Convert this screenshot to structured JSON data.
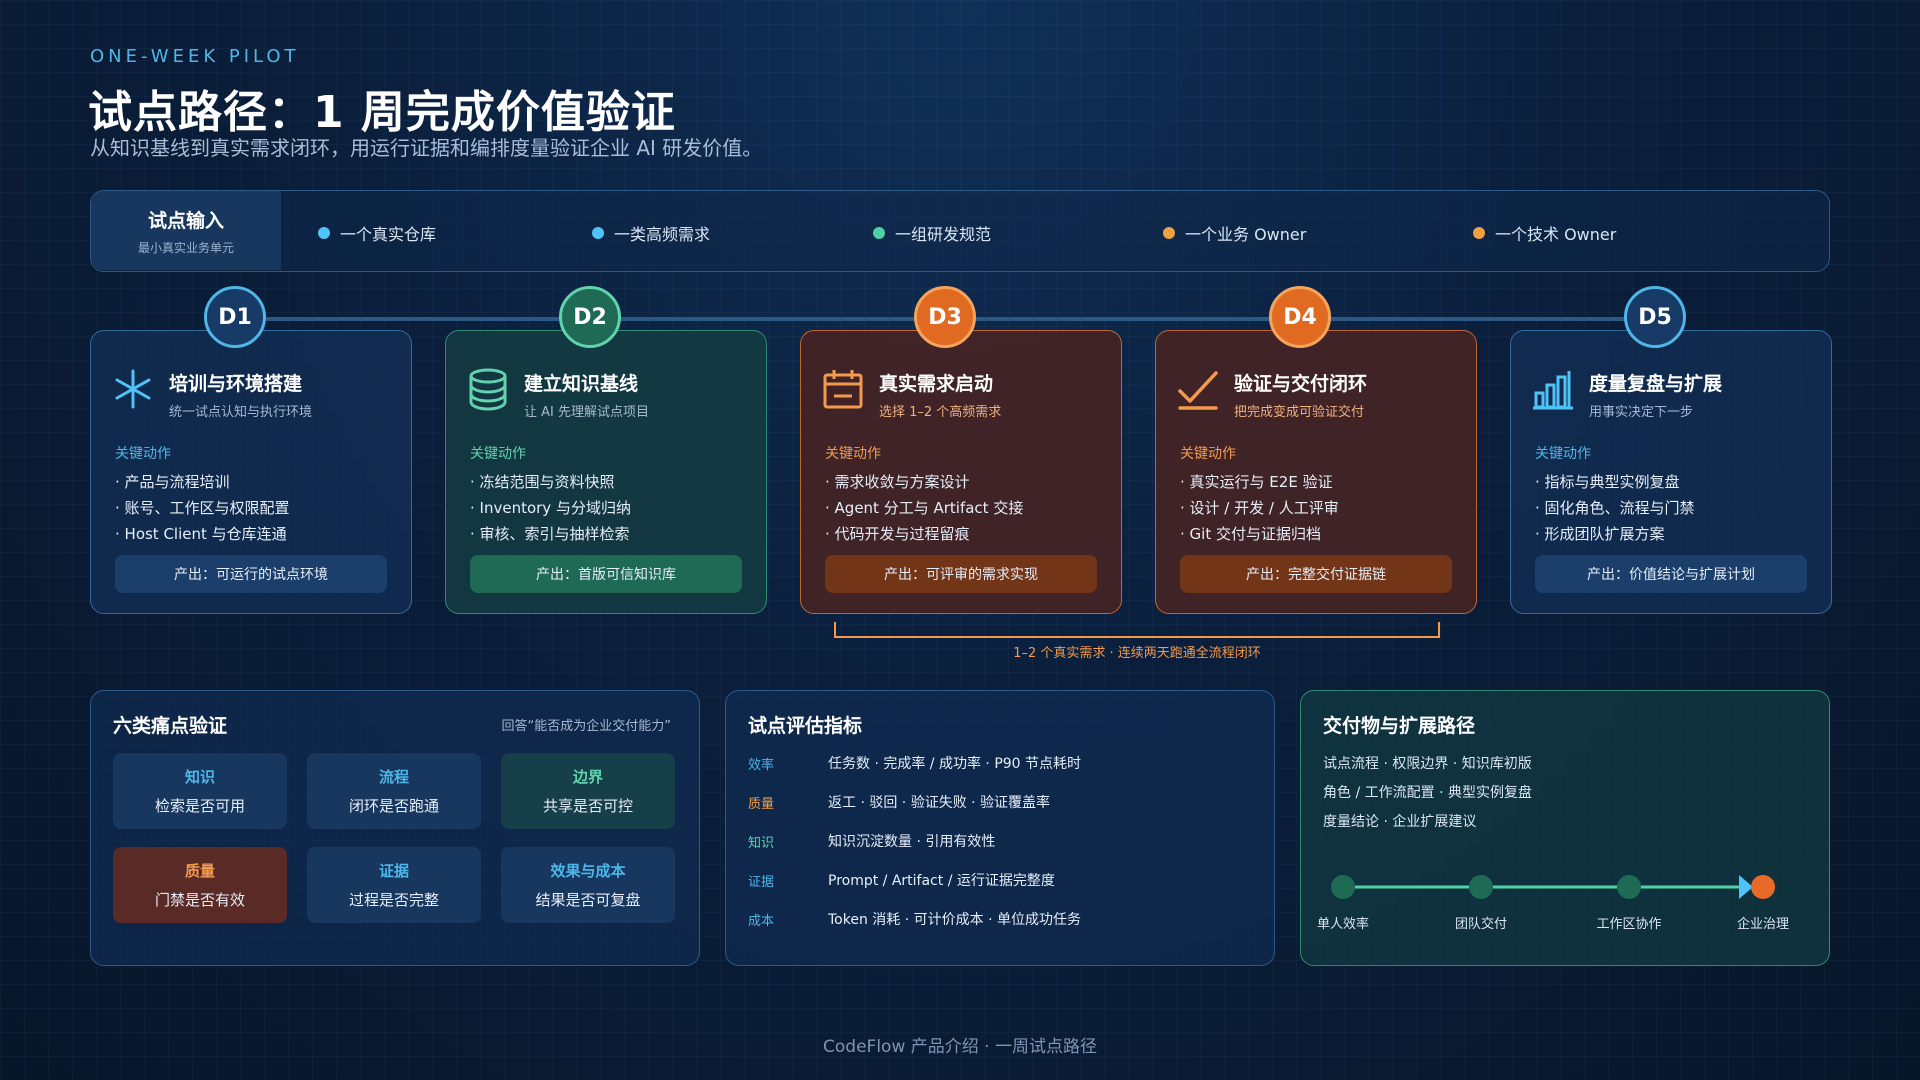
{
  "header": {
    "eyebrow": "ONE-WEEK PILOT",
    "title": "试点路径：1 周完成价值验证",
    "subtitle": "从知识基线到真实需求闭环，用运行证据和编排度量验证企业 AI 研发价值。"
  },
  "inputs": {
    "title": "试点输入",
    "subtitle": "最小真实业务单元",
    "items": [
      {
        "label": "一个真实仓库",
        "color": "#4fc3f7"
      },
      {
        "label": "一类高频需求",
        "color": "#4fc3f7"
      },
      {
        "label": "一组研发规范",
        "color": "#4fd1a5"
      },
      {
        "label": "一个业务 Owner",
        "color": "#f0a040"
      },
      {
        "label": "一个技术 Owner",
        "color": "#f0a040"
      }
    ]
  },
  "days": [
    {
      "badge": "D1",
      "icon": "asterisk-icon",
      "theme": "blue",
      "title": "培训与环境搭建",
      "subtitle": "统一试点认知与执行环境",
      "section": "关键动作",
      "actions": [
        "· 产品与流程培训",
        "· 账号、工作区与权限配置",
        "· Host Client 与仓库连通"
      ],
      "output": "产出：可运行的试点环境"
    },
    {
      "badge": "D2",
      "icon": "database-icon",
      "theme": "green",
      "title": "建立知识基线",
      "subtitle": "让 AI 先理解试点项目",
      "section": "关键动作",
      "actions": [
        "· 冻结范围与资料快照",
        "· Inventory 与分域归纳",
        "· 审核、索引与抽样检索"
      ],
      "output": "产出：首版可信知识库"
    },
    {
      "badge": "D3",
      "icon": "calendar-icon",
      "theme": "orange",
      "title": "真实需求启动",
      "subtitle": "选择 1–2 个高频需求",
      "section": "关键动作",
      "actions": [
        "· 需求收敛与方案设计",
        "· Agent 分工与 Artifact 交接",
        "· 代码开发与过程留痕"
      ],
      "output": "产出：可评审的需求实现"
    },
    {
      "badge": "D4",
      "icon": "checkmark-icon",
      "theme": "orange",
      "title": "验证与交付闭环",
      "subtitle": "把完成变成可验证交付",
      "section": "关键动作",
      "actions": [
        "· 真实运行与 E2E 验证",
        "· 设计 / 开发 / 人工评审",
        "· Git 交付与证据归档"
      ],
      "output": "产出：完整交付证据链"
    },
    {
      "badge": "D5",
      "icon": "bar-chart-icon",
      "theme": "blue",
      "title": "度量复盘与扩展",
      "subtitle": "用事实决定下一步",
      "section": "关键动作",
      "actions": [
        "· 指标与典型实例复盘",
        "· 固化角色、流程与门禁",
        "· 形成团队扩展方案"
      ],
      "output": "产出：价值结论与扩展计划"
    }
  ],
  "bracket_label": "1–2 个真实需求 · 连续两天跑通全流程闭环",
  "pain_points": {
    "title": "六类痛点验证",
    "note": "回答“能否成为企业交付能力”",
    "tiles": [
      {
        "title": "知识",
        "text": "检索是否可用",
        "theme": "blue"
      },
      {
        "title": "流程",
        "text": "闭环是否跑通",
        "theme": "blue"
      },
      {
        "title": "边界",
        "text": "共享是否可控",
        "theme": "green"
      },
      {
        "title": "质量",
        "text": "门禁是否有效",
        "theme": "red"
      },
      {
        "title": "证据",
        "text": "过程是否完整",
        "theme": "blue"
      },
      {
        "title": "效果与成本",
        "text": "结果是否可复盘",
        "theme": "blue"
      }
    ]
  },
  "metrics": {
    "title": "试点评估指标",
    "rows": [
      {
        "key": "效率",
        "value": "任务数 · 完成率 / 成功率 · P90 节点耗时",
        "color": "#4fb6e8"
      },
      {
        "key": "质量",
        "value": "返工 · 驳回 · 验证失败 · 验证覆盖率",
        "color": "#f39a4d"
      },
      {
        "key": "知识",
        "value": "知识沉淀数量 · 引用有效性",
        "color": "#62d2ae"
      },
      {
        "key": "证据",
        "value": "Prompt / Artifact / 运行证据完整度",
        "color": "#4fb6e8"
      },
      {
        "key": "成本",
        "value": "Token 消耗 · 可计价成本 · 单位成功任务",
        "color": "#4fb6e8"
      }
    ]
  },
  "deliverables": {
    "title": "交付物与扩展路径",
    "lines": [
      "试点流程 · 权限边界 · 知识库初版",
      "角色 / 工作流配置 · 典型实例复盘",
      "度量结论 · 企业扩展建议"
    ],
    "path": [
      "单人效率",
      "团队交付",
      "工作区协作",
      "企业治理"
    ]
  },
  "footer": "CodeFlow 产品介绍 · 一周试点路径"
}
